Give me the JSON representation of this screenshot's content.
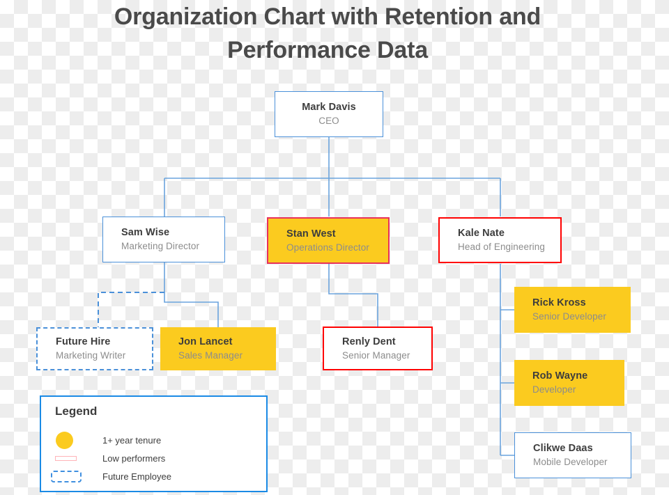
{
  "title": "Organization Chart with Retention and Performance Data",
  "colors": {
    "gold": "#fbcb1f",
    "blue_border": "#4a90d9",
    "red_border": "#ff0000",
    "crimson_border": "#e8315c",
    "legend_border": "#1a8ae5",
    "connector": "#6aa3dd",
    "title_text": "#4a4a4a",
    "name_text": "#3d3d3d",
    "role_text": "#8c8c8c"
  },
  "nodes": [
    {
      "id": "ceo",
      "name": "Mark Davis",
      "role": "CEO",
      "style": "blue"
    },
    {
      "id": "marketing",
      "name": "Sam Wise",
      "role": "Marketing Director",
      "style": "blue"
    },
    {
      "id": "operations",
      "name": "Stan West",
      "role": "Operations Director",
      "style": "gold-red"
    },
    {
      "id": "engineering",
      "name": "Kale Nate",
      "role": "Head of Engineering",
      "style": "red"
    },
    {
      "id": "future",
      "name": "Future Hire",
      "role": "Marketing Writer",
      "style": "dashed"
    },
    {
      "id": "sales",
      "name": "Jon Lancet",
      "role": "Sales Manager",
      "style": "gold"
    },
    {
      "id": "senior-mgr",
      "name": "Renly Dent",
      "role": "Senior Manager",
      "style": "red"
    },
    {
      "id": "sr-dev",
      "name": "Rick Kross",
      "role": "Senior Developer",
      "style": "gold"
    },
    {
      "id": "dev",
      "name": "Rob Wayne",
      "role": "Developer",
      "style": "gold"
    },
    {
      "id": "mobile-dev",
      "name": "Clikwe Daas",
      "role": "Mobile Developer",
      "style": "blue"
    }
  ],
  "legend": {
    "title": "Legend",
    "items": [
      {
        "swatch": "yellow-circle",
        "label": "1+ year tenure"
      },
      {
        "swatch": "pink-rectangle",
        "label": "Low performers"
      },
      {
        "swatch": "dashed-rectangle",
        "label": "Future Employee"
      }
    ]
  }
}
